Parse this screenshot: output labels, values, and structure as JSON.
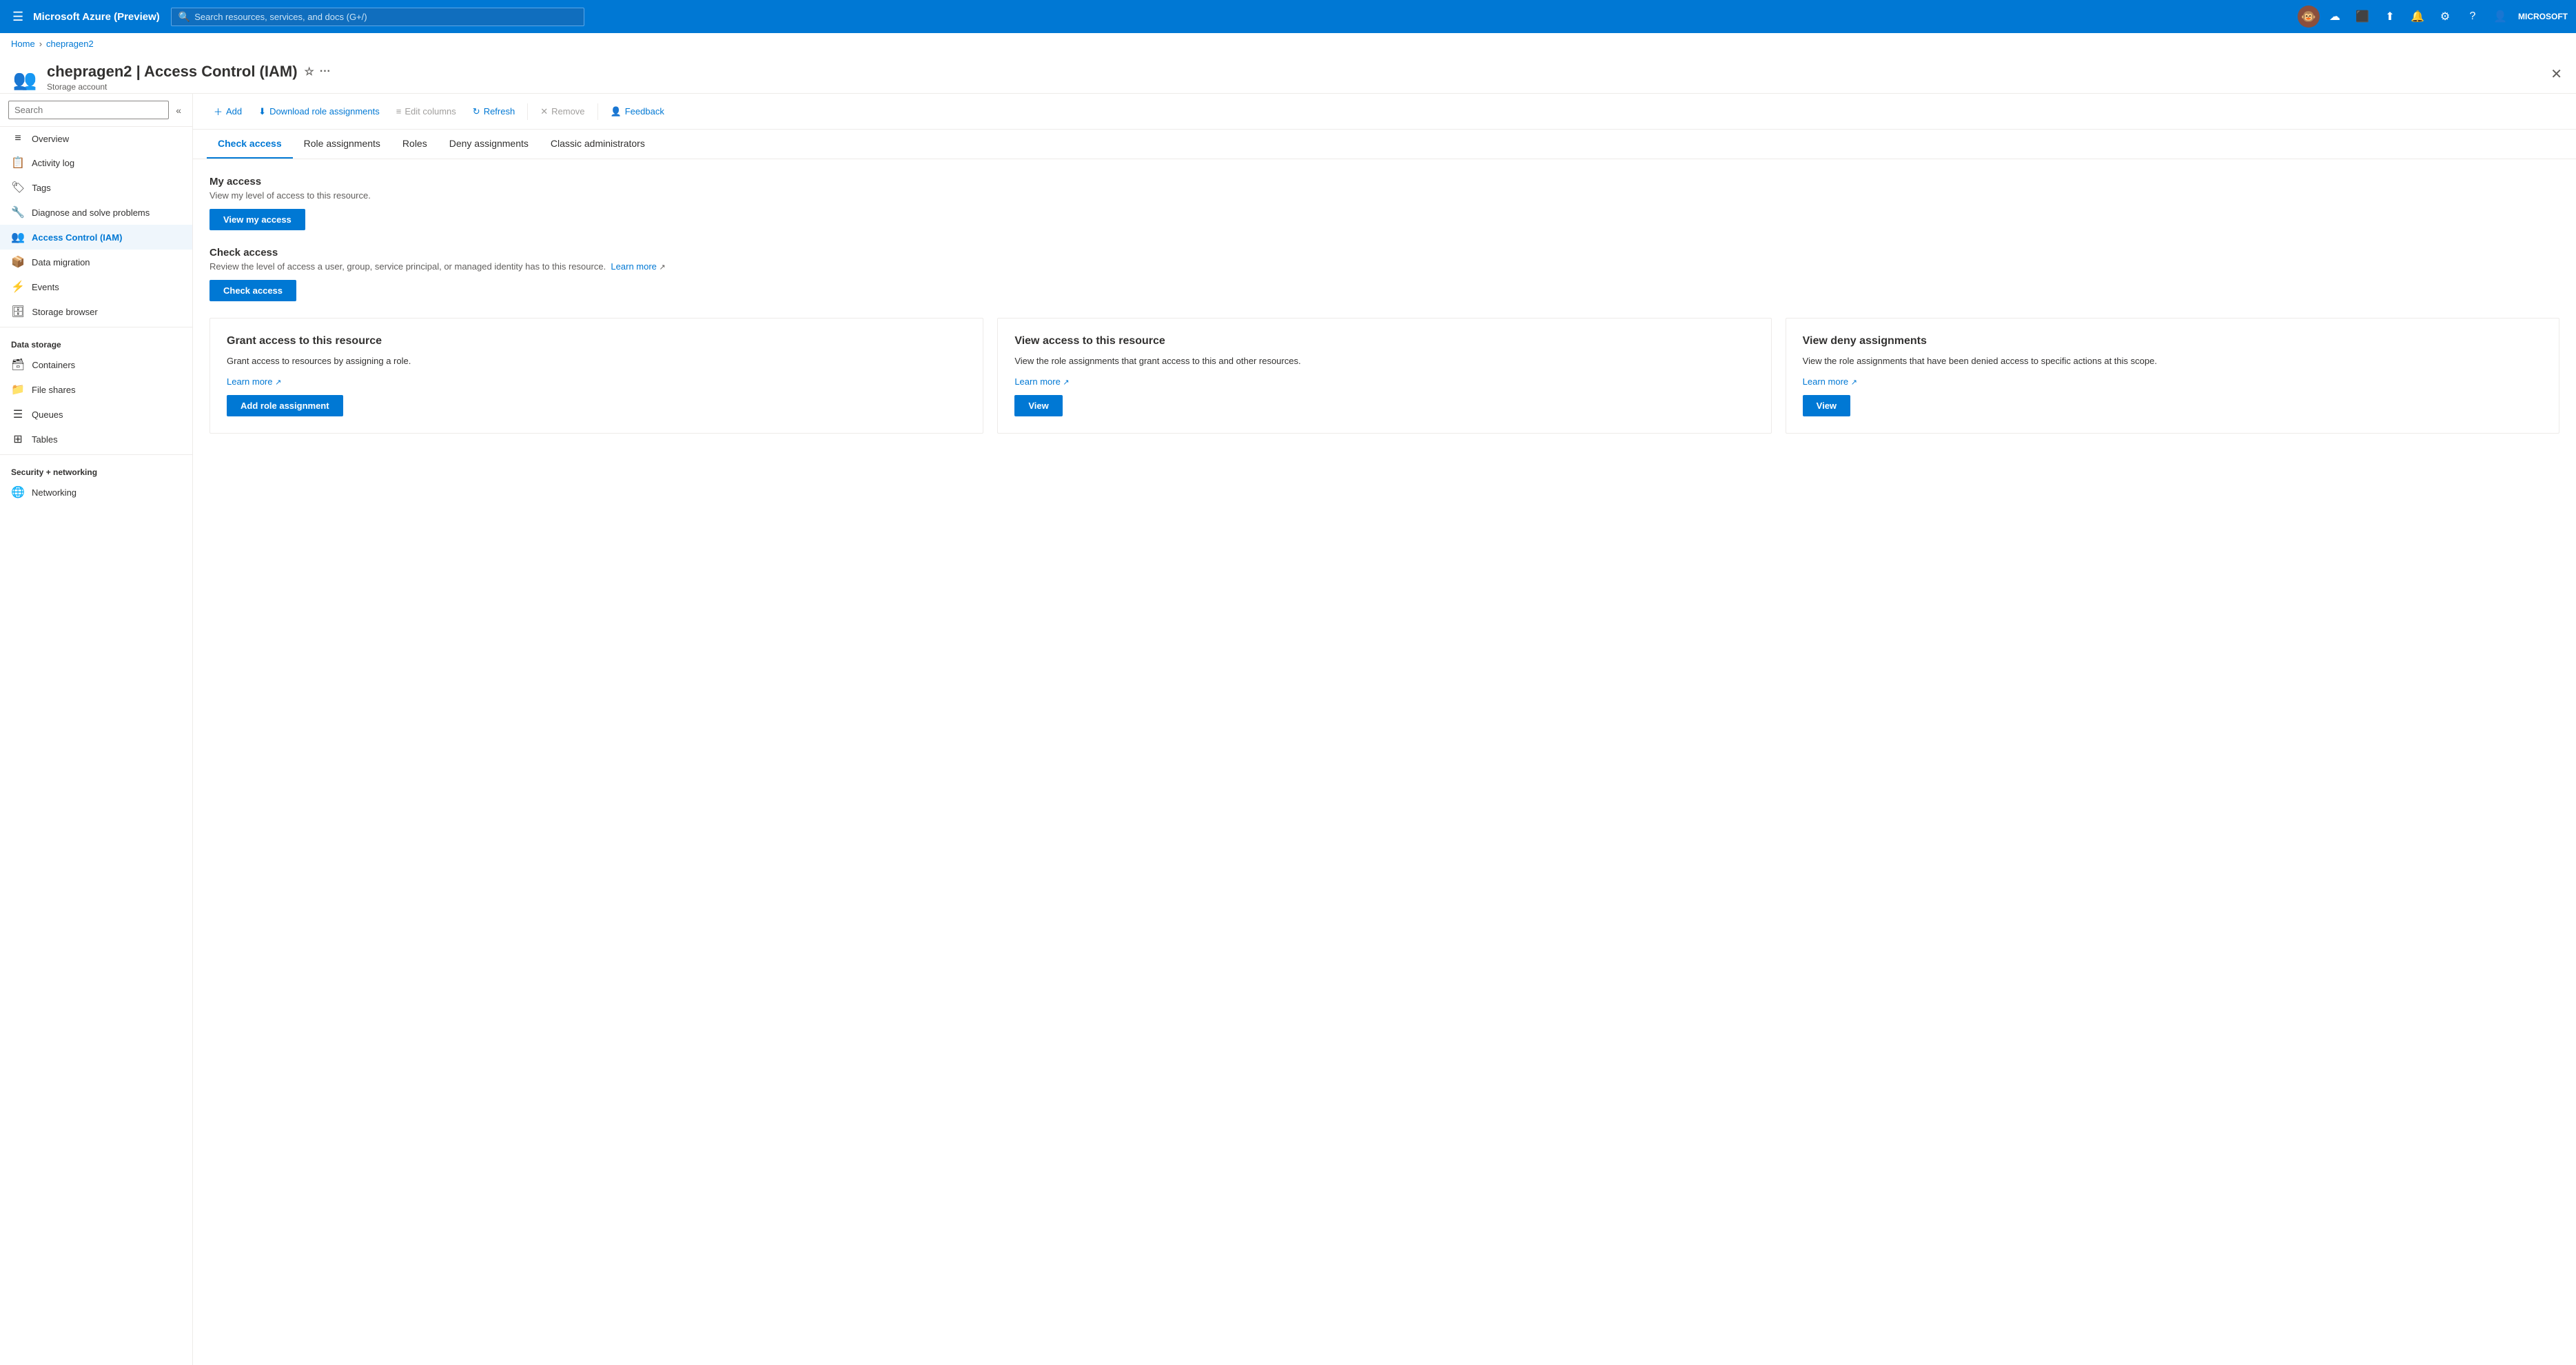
{
  "topnav": {
    "brand": "Microsoft Azure (Preview)",
    "search_placeholder": "Search resources, services, and docs (G+/)",
    "microsoft_label": "MICROSOFT"
  },
  "breadcrumb": {
    "home": "Home",
    "current": "chepragen2"
  },
  "page_header": {
    "title": "chepragen2 | Access Control (IAM)",
    "subtitle": "Storage account"
  },
  "sidebar": {
    "search_placeholder": "Search",
    "items": [
      {
        "label": "Overview",
        "icon": "≡",
        "active": false
      },
      {
        "label": "Activity log",
        "icon": "📋",
        "active": false
      },
      {
        "label": "Tags",
        "icon": "🏷",
        "active": false
      },
      {
        "label": "Diagnose and solve problems",
        "icon": "🔧",
        "active": false
      },
      {
        "label": "Access Control (IAM)",
        "icon": "👥",
        "active": true
      },
      {
        "label": "Data migration",
        "icon": "📦",
        "active": false
      },
      {
        "label": "Events",
        "icon": "⚡",
        "active": false
      },
      {
        "label": "Storage browser",
        "icon": "🗄",
        "active": false
      }
    ],
    "data_storage_label": "Data storage",
    "data_storage_items": [
      {
        "label": "Containers",
        "icon": "🗃"
      },
      {
        "label": "File shares",
        "icon": "📁"
      },
      {
        "label": "Queues",
        "icon": "☰"
      },
      {
        "label": "Tables",
        "icon": "⊞"
      }
    ],
    "security_label": "Security + networking",
    "security_items": [
      {
        "label": "Networking",
        "icon": "🌐"
      }
    ]
  },
  "toolbar": {
    "add_label": "Add",
    "download_label": "Download role assignments",
    "edit_columns_label": "Edit columns",
    "refresh_label": "Refresh",
    "remove_label": "Remove",
    "feedback_label": "Feedback"
  },
  "tabs": [
    {
      "label": "Check access",
      "active": true
    },
    {
      "label": "Role assignments",
      "active": false
    },
    {
      "label": "Roles",
      "active": false
    },
    {
      "label": "Deny assignments",
      "active": false
    },
    {
      "label": "Classic administrators",
      "active": false
    }
  ],
  "my_access": {
    "title": "My access",
    "description": "View my level of access to this resource.",
    "button_label": "View my access"
  },
  "check_access": {
    "title": "Check access",
    "description": "Review the level of access a user, group, service principal, or managed identity has to this resource.",
    "learn_more": "Learn more",
    "button_label": "Check access"
  },
  "cards": [
    {
      "title": "Grant access to this resource",
      "description": "Grant access to resources by assigning a role.",
      "learn_more": "Learn more",
      "button_label": "Add role assignment"
    },
    {
      "title": "View access to this resource",
      "description": "View the role assignments that grant access to this and other resources.",
      "learn_more": "Learn more",
      "button_label": "View"
    },
    {
      "title": "View deny assignments",
      "description": "View the role assignments that have been denied access to specific actions at this scope.",
      "learn_more": "Learn more",
      "button_label": "View"
    }
  ]
}
